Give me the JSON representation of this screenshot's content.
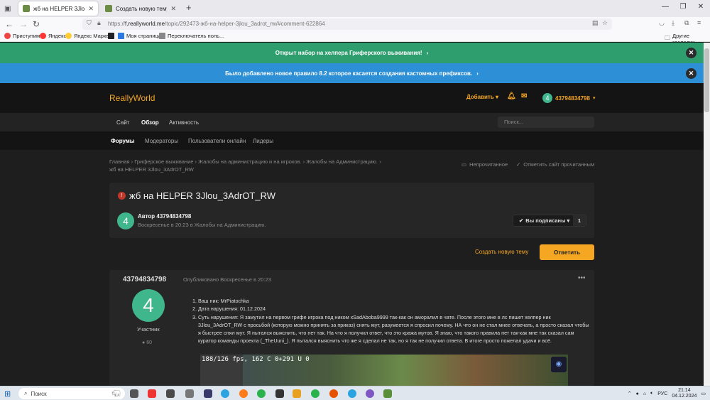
{
  "browser": {
    "tabs": [
      {
        "title": "жб на HELPER 3Jlou_3AdrOT_R",
        "active": true
      },
      {
        "title": "Создать новую тему - ReallyW",
        "active": false
      }
    ],
    "url_prefix": "https://",
    "url_host": "f.reallyworld.me",
    "url_path": "/topic/292473-жб-на-helper-3jlou_3adrot_rw/#comment-622864",
    "bookmarks": [
      "Приступим",
      "Яндекс",
      "Яндекс Маркет",
      "",
      "Моя страница",
      "Переключатель поль..."
    ],
    "other_bookmarks": "Другие закладки"
  },
  "banners": [
    {
      "text": "Открыт набор на хелпера Гриферского выживания!",
      "color": "#2e9e6e"
    },
    {
      "text": "Было добавлено новое правило 8.2 которое касается создания кастомных префиксов.",
      "color": "#2d8fd5"
    }
  ],
  "header": {
    "logo": "ReallyWorld",
    "add_label": "Добавить",
    "user_number": "4",
    "username": "43794834798"
  },
  "mainnav": {
    "items": [
      "Сайт",
      "Обзор",
      "Активность"
    ],
    "search_placeholder": "Поиск..."
  },
  "subnav": {
    "items": [
      "Форумы",
      "Модераторы",
      "Пользователи онлайн",
      "Лидеры"
    ]
  },
  "breadcrumb": {
    "items": [
      "Главная",
      "Гриферское выживание",
      "Жалобы на администрацию и на игроков.",
      "Жалобы на Администрацию.",
      "жб на HELPER 3Jlou_3AdrOT_RW"
    ],
    "unread": "Непрочитанное",
    "mark_read": "Отметить сайт прочитанным"
  },
  "topic": {
    "title": "жб на HELPER 3Jlou_3AdrOT_RW",
    "author_label": "Автор 43794834798",
    "meta": "Воскресенье в 20:23 в Жалобы на Администрацию.",
    "subscribe_label": "Вы подписаны",
    "subscribe_count": "1",
    "create_topic": "Создать новую тему",
    "reply": "Ответить"
  },
  "post": {
    "author": "43794834798",
    "avatar_letter": "4",
    "role": "Участник",
    "post_count": "60",
    "published": "Опубликовано Воскресенье в 20:23",
    "items": [
      "Ваш ник: MrPiatochka",
      "Дата нарушения: 01.12.2024",
      "Суть нарушения: Я замутил на первом грифе игрока под ником xSadAboba9999 так-как он аморалил в чате. После этого мне  в лс пишет хелпер ник 3Jlou_3AdrOT_RW с просьбой (которую можно принять за приказ) снять мут, разумеется я спросил почему. НА что он не стал мнее отвечать, а просто сказал чтобы я быстрее снял мут. Я пытался выяснить, что нет так. На что я получил ответ, что это кража мутов. Я знаю, что такого правила нет так-как мне так сказал сам куратор команды проекта (_TheUuni_). Я пытался выяснить что же я сделал не так, но я так не получил ответа. В итоге просто пожелал удачи и всё."
    ],
    "image_overlay": "188/126 fps, 162 C 0+291 U 0"
  },
  "taskbar": {
    "search": "Поиск",
    "lang": "РУС",
    "time": "21:14",
    "date": "04.12.2024"
  }
}
